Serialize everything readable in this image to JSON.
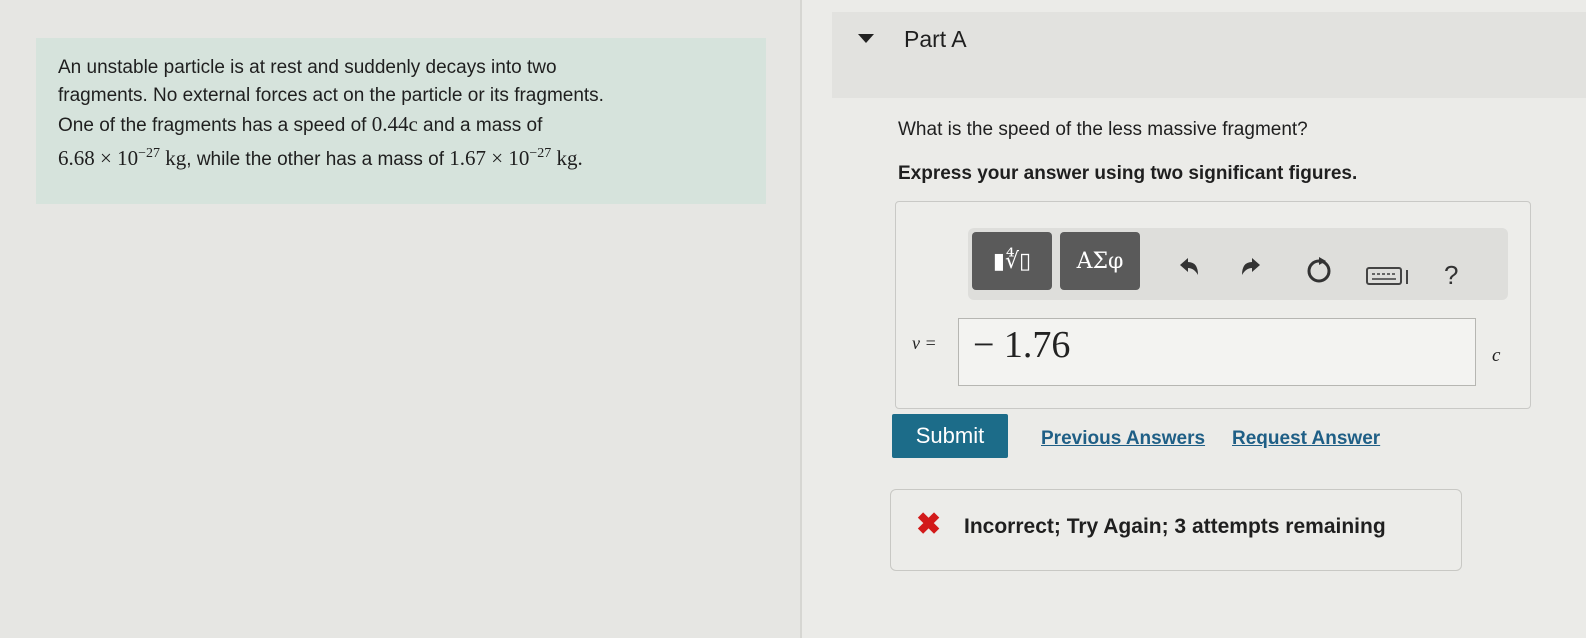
{
  "problem": {
    "line1": "An unstable particle is at rest and suddenly decays into two",
    "line2": "fragments. No external forces act on the particle or its fragments.",
    "line3_pre": "One of the fragments has a speed of ",
    "speed": "0.44c",
    "line3_post": " and a mass of",
    "mass1_base": "6.68 × 10",
    "mass1_exp": "−27",
    "mass_unit": "kg",
    "line4_mid": ", while the other has a mass of ",
    "mass2_base": "1.67 × 10",
    "mass2_exp": "−27",
    "mass2_unit": "kg."
  },
  "part": {
    "title": "Part A",
    "question": "What is the speed of the less massive fragment?",
    "instruction": "Express your answer using two significant figures."
  },
  "toolbar": {
    "templates_label": "▮∜▯",
    "greek_label": "ΑΣφ",
    "undo_icon": "undo-icon",
    "redo_icon": "redo-icon",
    "reset_icon": "reset-icon",
    "keyboard_icon": "keyboard-icon",
    "help_label": "?"
  },
  "answer": {
    "variable": "v =",
    "value": "− 1.76",
    "unit": "c"
  },
  "actions": {
    "submit_label": "Submit",
    "previous_answers_label": "Previous Answers",
    "request_answer_label": "Request Answer"
  },
  "feedback": {
    "icon": "x-icon",
    "text": "Incorrect; Try Again; 3 attempts remaining",
    "color": "#d21a1a"
  }
}
